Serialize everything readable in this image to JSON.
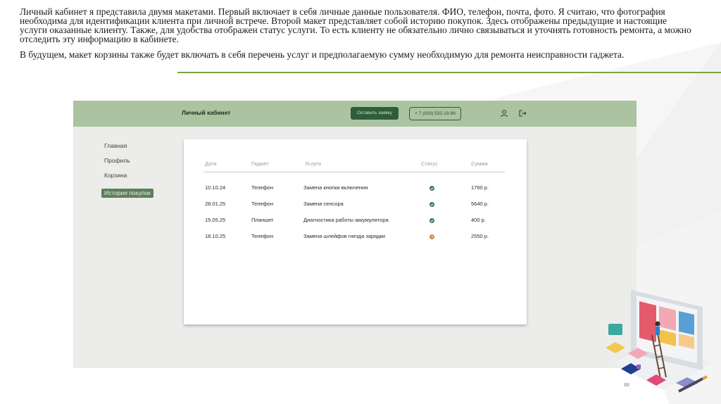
{
  "slide": {
    "paragraph1": "Личный кабинет я представила двумя макетами. Первый включает в себя личные данные пользователя. ФИО, телефон, почта, фото. Я считаю, что фотография необходима для идентификации клиента при личной встрече. Второй макет представляет собой историю покупок. Здесь отображены предыдущие и настоящие услуги оказанные клиенту. Также, для удобства отображен статус услуги. То есть клиенту не обязательно лично связываться и уточнять готовность ремонта, а можно отследить эту информацию в кабинете.",
    "paragraph2": "В будущем, макет корзины также будет включать в себя перечень услуг и предполагаемую сумму необходимую для ремонта неисправности гаджета.",
    "accent_color": "#7aa34a"
  },
  "mockup": {
    "header": {
      "title": "Личный кабинет",
      "cta_label": "Оставить заявку",
      "phone": "+ 7 (920) 532-19-99",
      "profile_icon": "profile-icon",
      "logout_icon": "logout-icon",
      "bg_color": "#abc3a0"
    },
    "sidebar": {
      "items": [
        {
          "label": "Главная"
        },
        {
          "label": "Профиль"
        },
        {
          "label": "Корзина"
        },
        {
          "label": "История покупок",
          "active": true
        }
      ]
    },
    "table": {
      "headers": [
        "Дата",
        "Гаджет",
        "Услуга",
        "Статус",
        "Сумма"
      ],
      "rows": [
        {
          "date": "10.10.24",
          "gadget": "Телефон",
          "service": "Замена кнопки включения",
          "status": "done",
          "sum": "1760 р."
        },
        {
          "date": "28.01.25",
          "gadget": "Телефон",
          "service": "Замена сенсора",
          "status": "done",
          "sum": "5640 р."
        },
        {
          "date": "15.05.25",
          "gadget": "Планшет",
          "service": "Диагностика работы аккумулятора",
          "status": "done",
          "sum": "400 р."
        },
        {
          "date": "18.10.25",
          "gadget": "Телефон",
          "service": "Замена шлейфов гнезда зарядки",
          "status": "pending",
          "sum": "2550 р."
        }
      ],
      "status_colors": {
        "done": "#3e7a4a",
        "pending": "#d38a3a"
      }
    }
  }
}
